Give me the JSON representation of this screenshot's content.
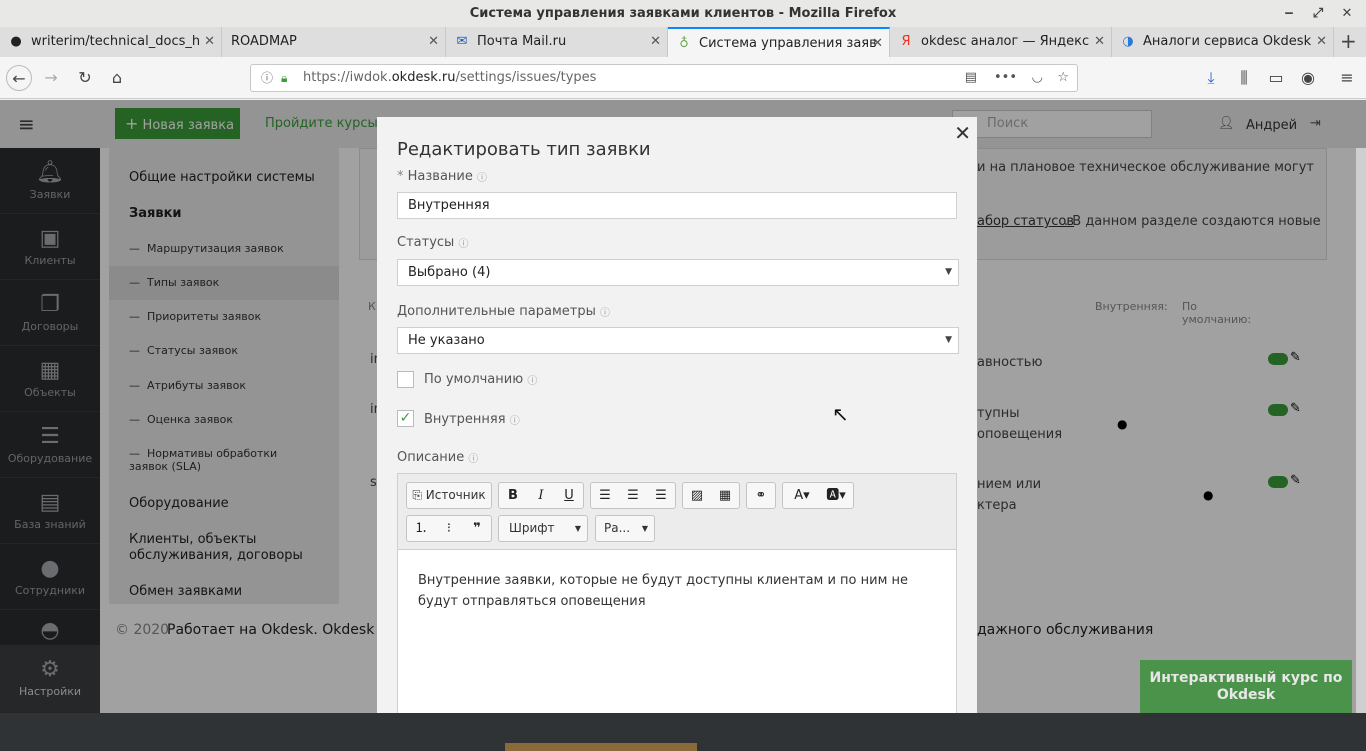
{
  "window": {
    "title": "Система управления заявками клиентов - Mozilla Firefox"
  },
  "tabs": [
    {
      "label": "writerim/technical_docs_h",
      "icon": "github-icon"
    },
    {
      "label": "ROADMAP",
      "icon": ""
    },
    {
      "label": "Почта Mail.ru",
      "icon": "mail-icon"
    },
    {
      "label": "Система управления заяв",
      "icon": "okdesk-icon"
    },
    {
      "label": "okdesc аналог — Яндекс",
      "icon": "yandex-icon"
    },
    {
      "label": "Аналоги сервиса Okdesk",
      "icon": "site-icon"
    }
  ],
  "url": {
    "prefix": "https://iwdok.",
    "domain": "okdesk.ru",
    "path": "/settings/issues/types"
  },
  "app": {
    "new_button": "Новая заявка",
    "courses_link": "Пройдите курсы в",
    "search_placeholder": "Поиск",
    "user_name": "Андрей",
    "footer_left": "© 2020",
    "footer_mid": "Работает на Okdesk. Okdesk —",
    "footer_right": "дажного обслуживания",
    "interactive_course": "Интерактивный курс по Okdesk"
  },
  "sidebar": [
    {
      "label": "Заявки",
      "icon": "bell-icon"
    },
    {
      "label": "Клиенты",
      "icon": "briefcase-icon"
    },
    {
      "label": "Договоры",
      "icon": "documents-icon"
    },
    {
      "label": "Объекты",
      "icon": "building-icon"
    },
    {
      "label": "Оборудование",
      "icon": "server-icon"
    },
    {
      "label": "База знаний",
      "icon": "book-icon"
    },
    {
      "label": "Сотрудники",
      "icon": "user-icon"
    },
    {
      "label": "Настройки",
      "icon": "gear-icon"
    }
  ],
  "settings_menu": {
    "general": "Общие настройки системы",
    "issues": "Заявки",
    "sub": [
      "Маршрутизация заявок",
      "Типы заявок",
      "Приоритеты заявок",
      "Статусы заявок",
      "Атрибуты заявок",
      "Оценка заявок",
      "Нормативы обработки заявок (SLA)"
    ],
    "equipment": "Оборудование",
    "clients": "Клиенты, объекты обслуживания, договоры",
    "exchange": "Обмен заявками"
  },
  "background": {
    "info1": "и на плановое техническое обслуживание могут",
    "info2_link": "абор статусов",
    "info2_rest": ". В данном разделе создаются новые",
    "col_internal": "Внутренняя:",
    "col_default": "По умолчанию:",
    "row1": "авностью",
    "row2a": "тупны",
    "row2b": "оповещения",
    "row3a": "нием или",
    "row3b": "ктера",
    "k": "К",
    "i1": "in",
    "i2": "in",
    "s": "s"
  },
  "modal": {
    "title": "Редактировать тип заявки",
    "name_label": "Название",
    "name_required": "*",
    "name_value": "Внутренняя",
    "statuses_label": "Статусы",
    "statuses_value": "Выбрано (4)",
    "params_label": "Дополнительные параметры",
    "params_value": "Не указано",
    "default_label": "По умолчанию",
    "default_checked": false,
    "internal_label": "Внутренняя",
    "internal_checked": true,
    "desc_label": "Описание",
    "source_button": "Источник",
    "font_select": "Шрифт",
    "size_select": "Ра...",
    "desc_text": "Внутренние заявки, которые не будут доступны клиентам и по ним не будут отправляться оповещения"
  }
}
